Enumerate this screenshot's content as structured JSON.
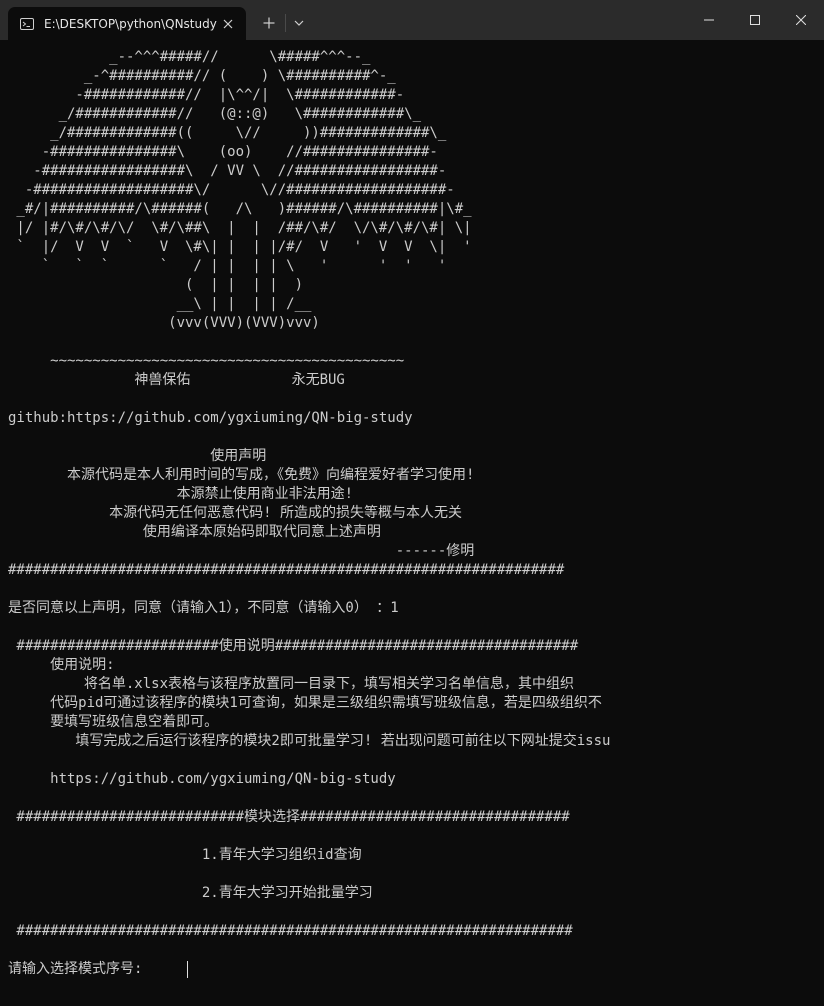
{
  "window": {
    "tab_title": "E:\\DESKTOP\\python\\QNstudy",
    "icons": {
      "tab": "terminal-icon",
      "tab_close": "close-icon",
      "new_tab": "plus-icon",
      "dropdown": "chevron-down-icon",
      "minimize": "minimize-icon",
      "maximize": "maximize-icon",
      "close": "close-icon"
    }
  },
  "terminal": {
    "colors": {
      "background": "#0c0c0c",
      "text": "#cccccc",
      "titlebar": "#2b2b2b"
    },
    "banner": [
      "            _--^^^#####//      \\#####^^^--_",
      "         _-^##########// (    ) \\##########^-_",
      "        -############//  |\\^^/|  \\############-",
      "      _/############//   (@::@)   \\############\\_",
      "     _/#############((     \\//     ))#############\\_",
      "    -###############\\    (oo)    //###############-",
      "   -#################\\  / VV \\  //#################-",
      "  -###################\\/      \\//###################-",
      " _#/|##########/\\######(   /\\   )######/\\##########|\\#_",
      " |/ |#/\\#/\\#/\\/  \\#/\\##\\  |  |  /##/\\#/  \\/\\#/\\#/\\#| \\|",
      " `  |/  V  V  `   V  \\#\\| |  | |/#/  V   '  V  V  \\|  '",
      "    `   `  `      `   / | |  | | \\   '      '  '   '",
      "                     (  | |  | |  )",
      "                    __\\ | |  | | /__",
      "                   (vvv(VVV)(VVV)vvv)"
    ],
    "tilde_line": "     ~~~~~~~~~~~~~~~~~~~~~~~~~~~~~~~~~~~~~~~~~~",
    "blessing": "               神兽保佑            永无BUG",
    "github_line": "github:https://github.com/ygxiuming/QN-big-study",
    "declaration_title": "                        使用声明",
    "declaration_lines": [
      "       本源代码是本人利用时间的写成，《免费》向编程爱好者学习使用!",
      "                    本源禁止使用商业非法用途!",
      "            本源代码无任何恶意代码! 所造成的损失等概与本人无关",
      "                使用编译本原始码即取代同意上述声明",
      "                                              ------修明"
    ],
    "hash_line": "##################################################################",
    "agree_prompt": "是否同意以上声明，同意（请输入1），不同意（请输入0） ：1",
    "usage_header": " ########################使用说明####################################",
    "usage_lines": [
      "     使用说明:",
      "         将名单.xlsx表格与该程序放置同一目录下，填写相关学习名单信息，其中组织",
      "     代码pid可通过该程序的模块1可查询，如果是三级组织需填写班级信息，若是四级组织不",
      "     要填写班级信息空着即可。",
      "        填写完成之后运行该程序的模块2即可批量学习! 若出现问题可前往以下网址提交issu"
    ],
    "usage_url": "     https://github.com/ygxiuming/QN-big-study",
    "module_header": " ###########################模块选择################################",
    "module_options": [
      "                       1.青年大学习组织id查询",
      "                       2.青年大学习开始批量学习"
    ],
    "footer_hash": " ##################################################################",
    "input_prompt": "请输入选择模式序号:"
  }
}
